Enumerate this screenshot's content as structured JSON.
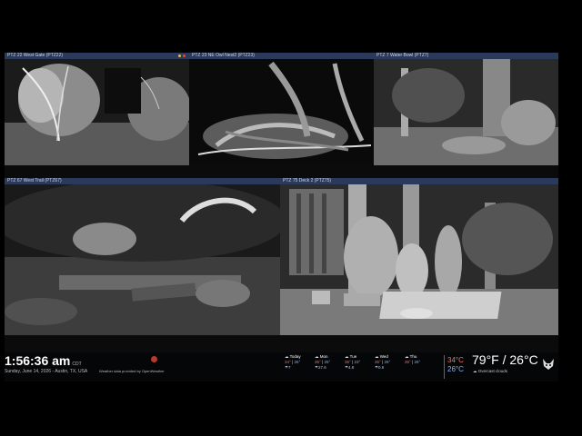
{
  "cameras": [
    {
      "title": "PTZ 22 West Gate (PTZ22)"
    },
    {
      "title": "PTZ 23 NE Owl Nest2 (PTZ23)"
    },
    {
      "title": "PTZ 7 Water Bowl (PTZ7)"
    },
    {
      "title": "PTZ 67 West Trail (PTZ67)"
    },
    {
      "title": "PTZ 75 Deck 2 (PTZ75)"
    }
  ],
  "clock": {
    "time": "1:56:36 am",
    "tz": "CDT",
    "date": "Sunday, June 14, 2026 - Austin, TX, USA"
  },
  "attribution": "Weather data provided by OpenWeather",
  "forecast": [
    {
      "day": "Today",
      "hi": "34°",
      "lo": "26°",
      "precip": "7"
    },
    {
      "day": "Mon",
      "hi": "35°",
      "lo": "25°",
      "precip": "27.6"
    },
    {
      "day": "Tue",
      "hi": "35°",
      "lo": "23°",
      "precip": "4.8"
    },
    {
      "day": "Wed",
      "hi": "35°",
      "lo": "26°",
      "precip": "0.6"
    },
    {
      "day": "Thu",
      "hi": "35°",
      "lo": "26°",
      "precip": ""
    }
  ],
  "current": {
    "hi": "34°C",
    "lo": "26°C",
    "temp_f": "79°F / 26°C",
    "condition": "Overcast clouds"
  },
  "colors": {
    "header": "#2b3a5a",
    "selected": "#d8553f",
    "hot": "#ff6a6a",
    "cold": "#7fb4ff"
  },
  "icons": {
    "weather": "cloud-icon",
    "logo": "fox-icon"
  }
}
